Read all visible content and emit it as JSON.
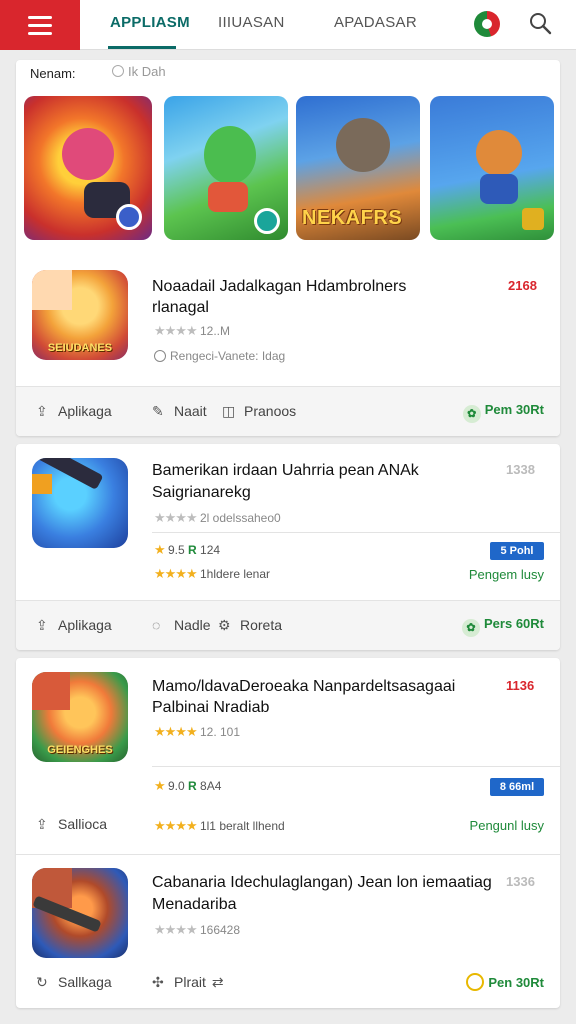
{
  "topbar": {
    "tabs": [
      "APPLIASM",
      "IIIUASAN",
      "APADASAR"
    ]
  },
  "featured": {
    "label": "Nenam:",
    "sublabel": "Ik Dah",
    "thumb3_text": "NEKAFRS"
  },
  "apps": [
    {
      "icon_text": "SEIUDANES",
      "title_line1": "Noaadail Jadalkagan Hdambrolners",
      "title_line2": "rlanagal",
      "rank": "2168",
      "stars_primary": "★★★★",
      "meta_primary": "12..M",
      "meta_secondary": "Rengeci-Vanete: Idag",
      "actions": [
        "Aplikaga",
        "Naait",
        "Pranoos"
      ],
      "cta": "Pem 30Rt"
    },
    {
      "title_line1": "Bamerikan irdaan Uahrria pean ANAk",
      "title_line2": "Saigrianarekg",
      "rank": "1338",
      "stars_primary": "★★★★",
      "meta_primary": "2l odelssaheo0",
      "rating": "9.5",
      "rating_count": "124",
      "badge": "5 Pohl",
      "stars_secondary": "★★★★",
      "meta_secondary": "1hldere lenar",
      "green_text": "Pengem lusy",
      "actions": [
        "Aplikaga",
        "Nadle",
        "Roreta"
      ],
      "cta": "Pers 60Rt"
    },
    {
      "icon_text": "GEIENGHES",
      "title_line1": "Mamo/ldavaDeroeaka Nanpardeltsasagaai",
      "title_line2": "Palbinai Nradiab",
      "rank": "1136",
      "stars_primary": "★★★★",
      "meta_primary": "12. 101",
      "rating": "9.0",
      "rating_count": "8A4",
      "badge": "8 66ml",
      "stars_secondary": "★★★★",
      "meta_secondary": "1l1 beralt llhend",
      "green_text": "Pengunl lusy",
      "actions": [
        "Sallioca"
      ]
    },
    {
      "title_line1": "Cabanaria Idechulaglangan) Jean lon iemaatiag",
      "title_line2": "Menadariba",
      "rank": "1336",
      "stars_primary": "★★★★",
      "meta_primary": "166428",
      "actions": [
        "Sallkaga",
        "Plrait"
      ],
      "cta": "Pen 30Rt"
    }
  ]
}
